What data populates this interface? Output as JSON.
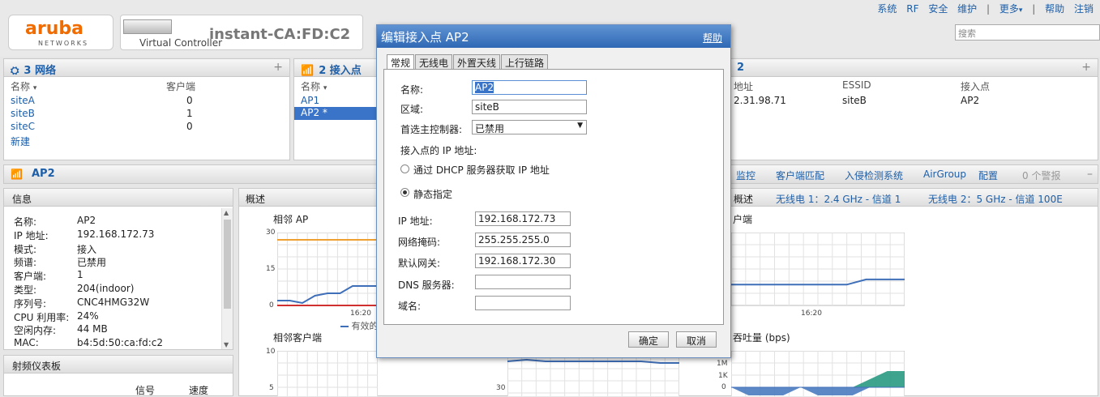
{
  "header": {
    "logo_word": "aruba",
    "logo_sub": "NETWORKS",
    "vc_label": "Virtual Controller",
    "vc_name": "instant-CA:FD:C2",
    "search_placeholder": "搜索",
    "nav": {
      "system": "系统",
      "rf": "RF",
      "security": "安全",
      "maintenance": "维护",
      "more": "更多",
      "help": "帮助",
      "logout": "注销"
    }
  },
  "networks": {
    "title": "3 网络",
    "col_name": "名称",
    "col_clients": "客户端",
    "rows": [
      {
        "name": "siteA",
        "clients": "0"
      },
      {
        "name": "siteB",
        "clients": "1"
      },
      {
        "name": "siteC",
        "clients": "0"
      }
    ],
    "new": "新建"
  },
  "aps": {
    "title": "2 接入点",
    "col_name": "名称",
    "rows": [
      {
        "name": "AP1"
      },
      {
        "name": "AP2 *"
      }
    ]
  },
  "clients_panel": {
    "title": "2",
    "col_addr": "地址",
    "col_essid": "ESSID",
    "col_ap": "接入点",
    "row": {
      "addr": "2.31.98.71",
      "essid": "siteB",
      "ap": "AP2"
    }
  },
  "ap2": {
    "title": "AP2",
    "links": {
      "monitor": "监控",
      "client_match": "客户端匹配",
      "ids": "入侵检测系统",
      "airgroup": "AirGroup",
      "config": "配置",
      "alerts": "0 个警报"
    }
  },
  "info": {
    "title": "信息",
    "rows": [
      {
        "k": "名称:",
        "v": "AP2"
      },
      {
        "k": "IP 地址:",
        "v": "192.168.172.73"
      },
      {
        "k": "模式:",
        "v": "接入"
      },
      {
        "k": "频谱:",
        "v": "已禁用"
      },
      {
        "k": "客户端:",
        "v": "1"
      },
      {
        "k": "类型:",
        "v": "204(indoor)"
      },
      {
        "k": "序列号:",
        "v": "CNC4HMG32W"
      },
      {
        "k": "CPU 利用率:",
        "v": "24%"
      },
      {
        "k": "空闲内存:",
        "v": "44 MB"
      },
      {
        "k": "MAC:",
        "v": "b4:5d:50:ca:fd:c2"
      }
    ]
  },
  "rf_dash": {
    "title": "射频仪表板",
    "col_signal": "信号",
    "col_speed": "速度"
  },
  "overview": {
    "title": "概述",
    "title2": "概述",
    "radio1": "无线电 1：2.4 GHz - 信道 1",
    "radio2": "无线电 2：5 GHz - 信道 100E"
  },
  "charts": {
    "neighbor_ap": "相邻 AP",
    "neighbor_clients": "相邻客户端",
    "clients": "户端",
    "throughput": "吞吐量 (bps)",
    "legend_valid": "有效的"
  },
  "chart_data": [
    {
      "type": "line",
      "title": "相邻 AP",
      "ylim": [
        0,
        30
      ],
      "yticks": [
        "30",
        "15",
        "0"
      ],
      "xticks": [
        "16:20"
      ],
      "series": [
        {
          "color": "#f0a030",
          "values": [
            27,
            27,
            27,
            27,
            27,
            27,
            27,
            27,
            27
          ]
        },
        {
          "color": "#3f6fb8",
          "values": [
            2,
            2,
            1,
            4,
            5,
            5,
            8,
            8,
            8
          ]
        },
        {
          "color": "#d03030",
          "values": [
            0,
            0,
            0,
            0,
            0,
            0,
            0,
            0,
            0
          ]
        }
      ]
    },
    {
      "type": "line",
      "title": "户端",
      "xticks": [
        "16:20"
      ],
      "series": [
        {
          "color": "#3f6fb8",
          "values": [
            0,
            0,
            0,
            0,
            0,
            0,
            0,
            1,
            1,
            1
          ]
        }
      ]
    },
    {
      "type": "line",
      "title": "相邻客户端",
      "yticks": [
        "10",
        "5"
      ],
      "series": []
    },
    {
      "type": "line",
      "yticks": [
        "30"
      ],
      "series": [
        {
          "color": "#3f6fb8",
          "values": [
            27,
            28,
            27,
            27,
            27,
            27,
            27,
            27,
            26,
            26
          ]
        }
      ]
    },
    {
      "type": "area",
      "title": "吞吐量 (bps)",
      "yticks": [
        "1M",
        "1K",
        "0"
      ],
      "series": [
        {
          "color": "#2a9a82",
          "values": [
            0,
            0,
            0,
            0,
            0,
            0,
            0,
            0,
            1,
            2,
            2
          ]
        },
        {
          "color": "#4a7cc0",
          "values": [
            0,
            -1,
            -1,
            -1,
            0,
            -1,
            -1,
            -1,
            0,
            0,
            0
          ]
        }
      ]
    }
  ],
  "dialog": {
    "title": "编辑接入点 AP2",
    "help": "帮助",
    "tabs": [
      "常规",
      "无线电",
      "外置天线",
      "上行链路"
    ],
    "name_label": "名称:",
    "name_value": "AP2",
    "zone_label": "区域:",
    "zone_value": "siteB",
    "pref_label": "首选主控制器:",
    "pref_value": "已禁用",
    "ip_heading": "接入点的 IP 地址:",
    "dhcp_label": "通过 DHCP 服务器获取 IP 地址",
    "static_label": "静态指定",
    "ip_label": "IP 地址:",
    "ip_value": "192.168.172.73",
    "mask_label": "网络掩码:",
    "mask_value": "255.255.255.0",
    "gw_label": "默认网关:",
    "gw_value": "192.168.172.30",
    "dns_label": "DNS 服务器:",
    "dns_value": "",
    "domain_label": "域名:",
    "domain_value": "",
    "ok": "确定",
    "cancel": "取消"
  }
}
